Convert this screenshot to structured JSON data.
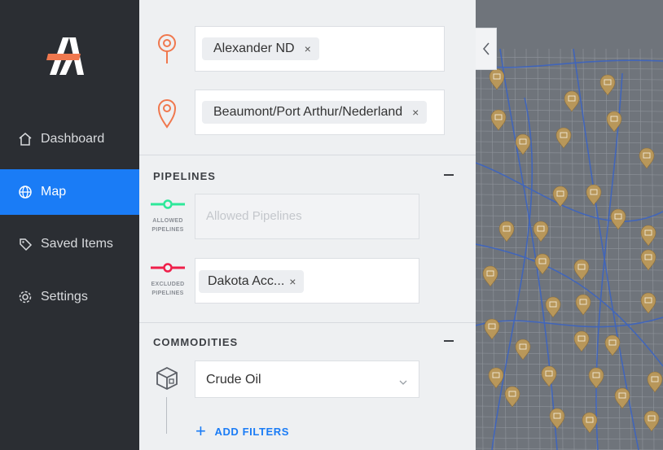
{
  "sidebar": {
    "items": [
      {
        "label": "Dashboard",
        "icon": "home-icon"
      },
      {
        "label": "Map",
        "icon": "globe-icon",
        "active": true
      },
      {
        "label": "Saved Items",
        "icon": "tag-icon"
      },
      {
        "label": "Settings",
        "icon": "gear-icon"
      }
    ]
  },
  "locations": {
    "origin": {
      "chip": "Alexander ND",
      "remove": "×"
    },
    "destination": {
      "chip": "Beaumont/Port Arthur/Nederland",
      "remove": "×"
    }
  },
  "pipelines": {
    "title": "PIPELINES",
    "allowed": {
      "label_line1": "ALLOWED",
      "label_line2": "PIPELINES",
      "placeholder": "Allowed Pipelines"
    },
    "excluded": {
      "label_line1": "EXCLUDED",
      "label_line2": "PIPELINES",
      "chip": "Dakota Acc...",
      "remove": "×"
    }
  },
  "commodities": {
    "title": "COMMODITIES",
    "selected": "Crude Oil"
  },
  "add_filters": {
    "plus": "+",
    "label": "ADD FILTERS"
  },
  "colors": {
    "accent": "#1a7cf6",
    "sidebar_bg": "#2b2e33",
    "pin": "#f0784e",
    "allowed": "#2ee89a",
    "excluded": "#ef1f4a",
    "map_marker": "#b8975a"
  }
}
